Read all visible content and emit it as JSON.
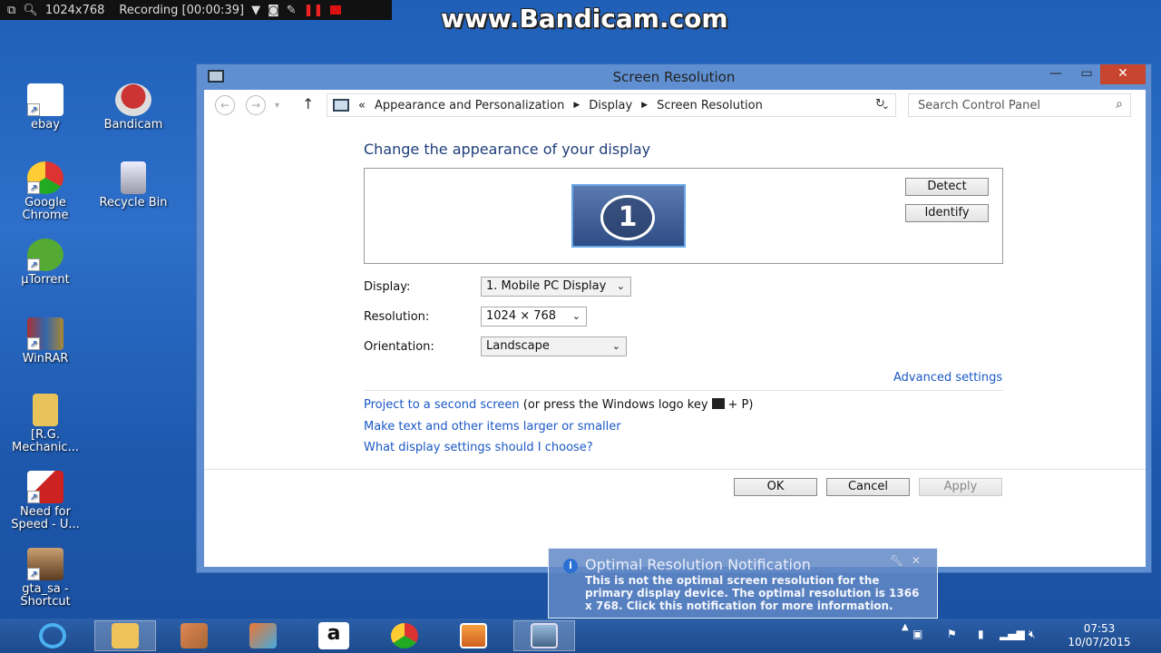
{
  "recorder": {
    "resolution": "1024x768",
    "recording": "Recording [00:00:39]"
  },
  "watermark": "www.Bandicam.com",
  "desktop": {
    "icons": [
      {
        "label": "ebay"
      },
      {
        "label": "Bandicam"
      },
      {
        "label": "Google Chrome"
      },
      {
        "label": "Recycle Bin"
      },
      {
        "label": "µTorrent"
      },
      {
        "label": "WinRAR"
      },
      {
        "label": "[R.G. Mechanic..."
      },
      {
        "label": "Need for Speed - U..."
      },
      {
        "label": "gta_sa - Shortcut"
      }
    ]
  },
  "window": {
    "title": "Screen Resolution",
    "breadcrumb": {
      "prefix": "«",
      "items": [
        "Appearance and Personalization",
        "Display",
        "Screen Resolution"
      ]
    },
    "search_placeholder": "Search Control Panel",
    "heading": "Change the appearance of your display",
    "monitor_number": "1",
    "detect_label": "Detect",
    "identify_label": "Identify",
    "display_label": "Display:",
    "display_value": "1. Mobile PC Display",
    "resolution_label": "Resolution:",
    "resolution_value": "1024 × 768",
    "orientation_label": "Orientation:",
    "orientation_value": "Landscape",
    "advanced_link": "Advanced settings",
    "project_link": "Project to a second screen",
    "project_hint_before": "(or press the Windows logo key",
    "project_hint_after": "+ P)",
    "text_size_link": "Make text and other items larger or smaller",
    "what_settings_link": "What display settings should I choose?",
    "ok_label": "OK",
    "cancel_label": "Cancel",
    "apply_label": "Apply"
  },
  "notification": {
    "title": "Optimal Resolution Notification",
    "body": "This is not the optimal screen resolution for the primary display device. The optimal resolution is 1366 x 768. Click this notification for more information."
  },
  "taskbar": {
    "time": "07:53",
    "date": "10/07/2015"
  },
  "colors": {
    "desktop": "#2d6fca",
    "link": "#1a58c6",
    "close_button": "#c7452f",
    "heading": "#1e3d7a"
  }
}
